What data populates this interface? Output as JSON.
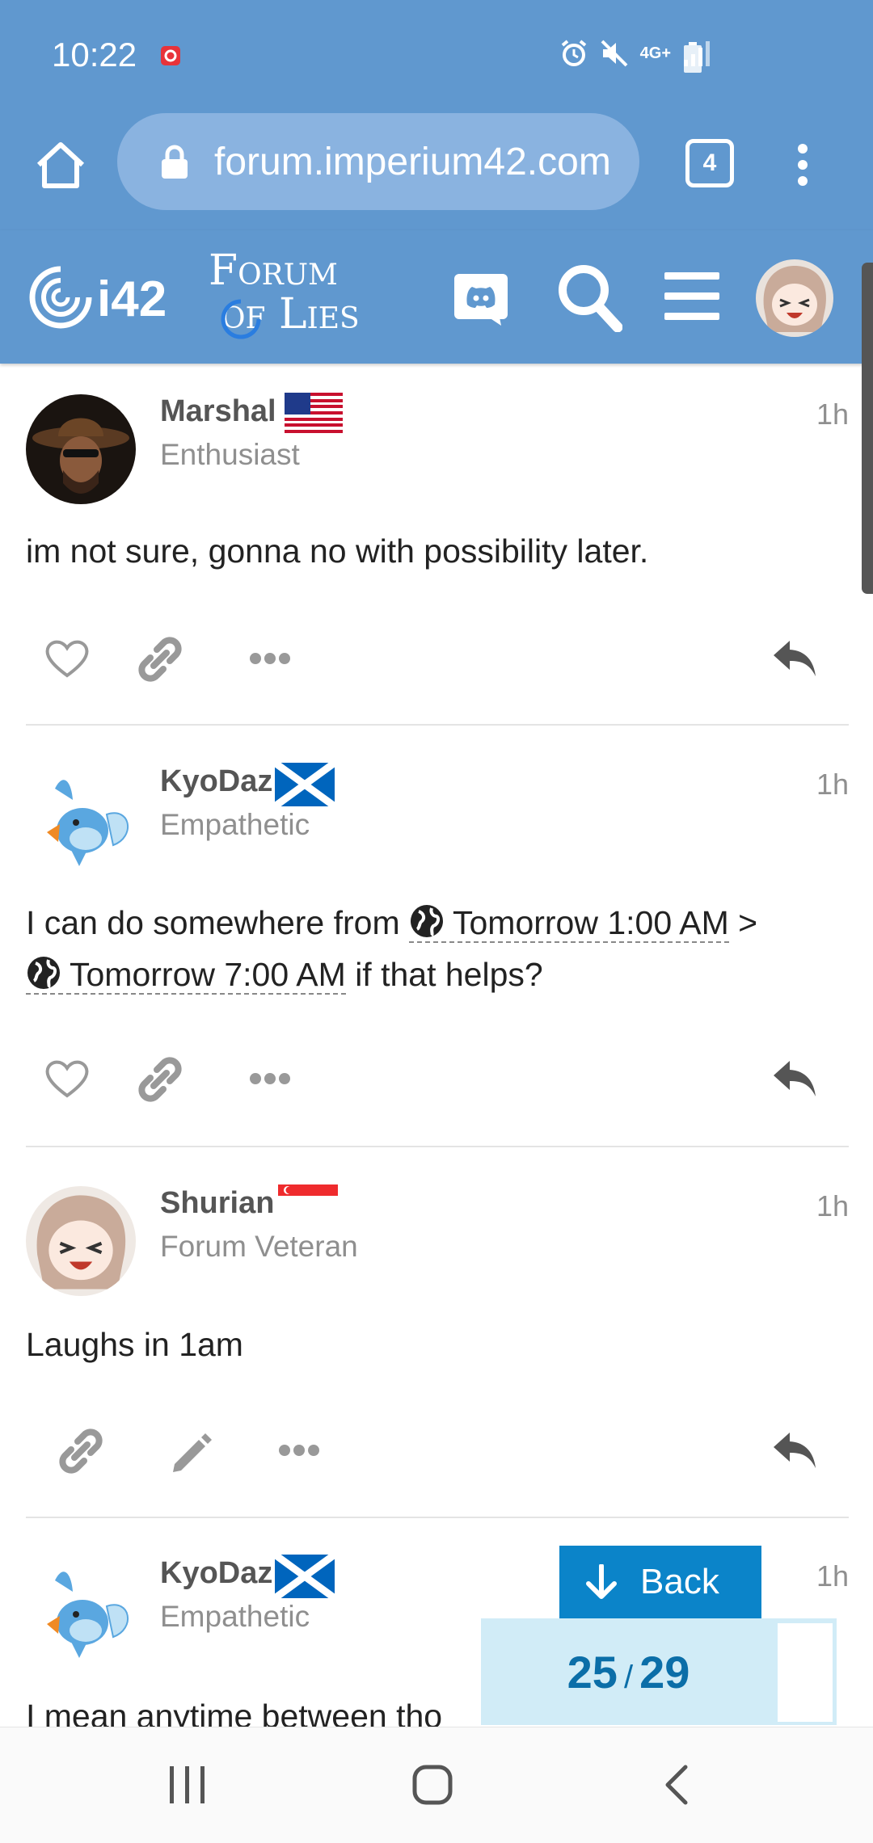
{
  "status_bar": {
    "time": "10:22",
    "network": "4G+"
  },
  "browser": {
    "url": "forum.imperium42.com",
    "tab_count": "4"
  },
  "site": {
    "logo_i42": "i42",
    "logo_forum_line1": "Forum",
    "logo_forum_line2": "of Lies"
  },
  "posts": [
    {
      "username": "Marshal",
      "title": "Enthusiast",
      "age": "1h",
      "flag": "us-flag",
      "body": "im not sure, gonna no with possibility later."
    },
    {
      "username": "KyoDaz",
      "title": "Empathetic",
      "age": "1h",
      "flag": "scotland-flag",
      "body_prefix": "I can do somewhere from ",
      "date_start": "Tomorrow 1:00 AM",
      "body_mid": " >",
      "date_end": "Tomorrow 7:00 AM",
      "body_suffix": " if that helps?"
    },
    {
      "username": "Shurian",
      "title": "Forum Veteran",
      "age": "1h",
      "flag": "singapore-flag",
      "body": "Laughs in 1am"
    },
    {
      "username": "KyoDaz",
      "title": "Empathetic",
      "age": "1h",
      "flag": "scotland-flag",
      "body": "I mean anytime between tho"
    }
  ],
  "timeline": {
    "back_label": "Back",
    "current": "25",
    "separator": "/",
    "total": "29"
  },
  "colors": {
    "header_blue": "#6098cf",
    "back_button": "#0b84c9",
    "progress_bg": "#d1ecf7"
  }
}
